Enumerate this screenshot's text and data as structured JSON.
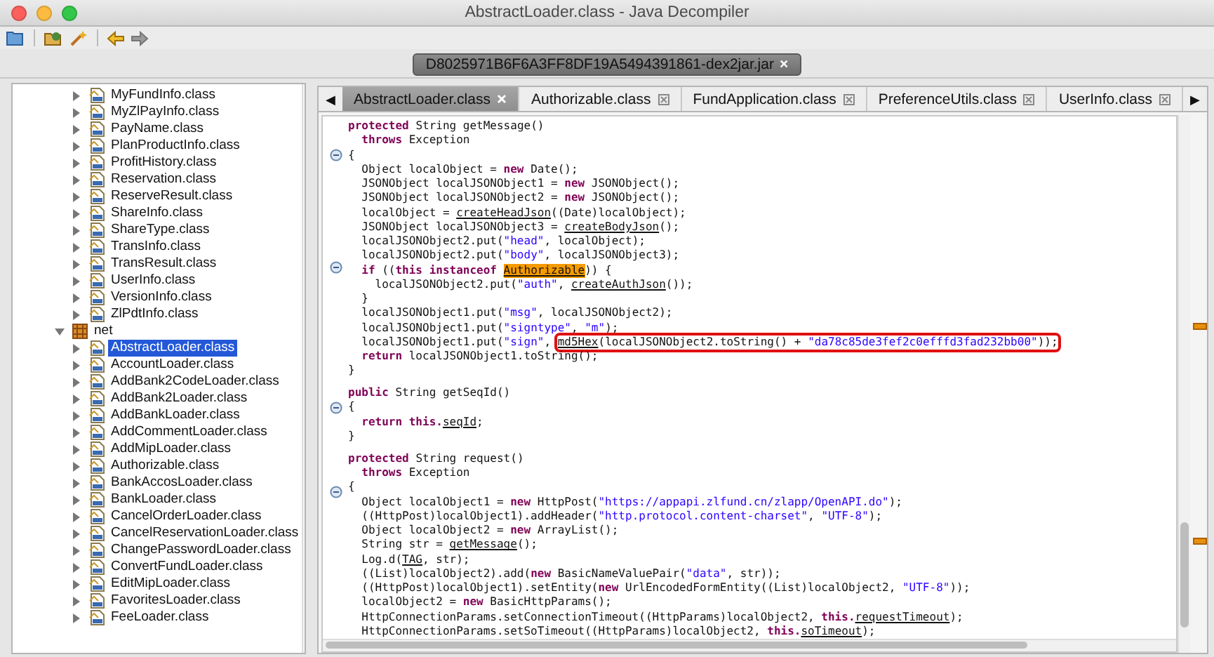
{
  "window": {
    "title": "AbstractLoader.class - Java Decompiler"
  },
  "jar_tab": {
    "label": "D8025971B6F6A3FF8DF19A5494391861-dex2jar.jar",
    "close": "×"
  },
  "tree": {
    "items": [
      {
        "kind": "class",
        "label": "MyFundInfo.class",
        "selected": false,
        "expanded": false
      },
      {
        "kind": "class",
        "label": "MyZlPayInfo.class",
        "selected": false,
        "expanded": false
      },
      {
        "kind": "class",
        "label": "PayName.class",
        "selected": false,
        "expanded": false
      },
      {
        "kind": "class",
        "label": "PlanProductInfo.class",
        "selected": false,
        "expanded": false
      },
      {
        "kind": "class",
        "label": "ProfitHistory.class",
        "selected": false,
        "expanded": false
      },
      {
        "kind": "class",
        "label": "Reservation.class",
        "selected": false,
        "expanded": false
      },
      {
        "kind": "class",
        "label": "ReserveResult.class",
        "selected": false,
        "expanded": false
      },
      {
        "kind": "class",
        "label": "ShareInfo.class",
        "selected": false,
        "expanded": false
      },
      {
        "kind": "class",
        "label": "ShareType.class",
        "selected": false,
        "expanded": false
      },
      {
        "kind": "class",
        "label": "TransInfo.class",
        "selected": false,
        "expanded": false
      },
      {
        "kind": "class",
        "label": "TransResult.class",
        "selected": false,
        "expanded": false
      },
      {
        "kind": "class",
        "label": "UserInfo.class",
        "selected": false,
        "expanded": false
      },
      {
        "kind": "class",
        "label": "VersionInfo.class",
        "selected": false,
        "expanded": false
      },
      {
        "kind": "class",
        "label": "ZlPdtInfo.class",
        "selected": false,
        "expanded": false
      },
      {
        "kind": "package",
        "label": "net",
        "selected": false,
        "expanded": true,
        "children": [
          {
            "kind": "class",
            "label": "AbstractLoader.class",
            "selected": true,
            "expanded": false
          },
          {
            "kind": "class",
            "label": "AccountLoader.class",
            "selected": false,
            "expanded": false
          },
          {
            "kind": "class",
            "label": "AddBank2CodeLoader.class",
            "selected": false,
            "expanded": false
          },
          {
            "kind": "class",
            "label": "AddBank2Loader.class",
            "selected": false,
            "expanded": false
          },
          {
            "kind": "class",
            "label": "AddBankLoader.class",
            "selected": false,
            "expanded": false
          },
          {
            "kind": "class",
            "label": "AddCommentLoader.class",
            "selected": false,
            "expanded": false
          },
          {
            "kind": "class",
            "label": "AddMipLoader.class",
            "selected": false,
            "expanded": false
          },
          {
            "kind": "class",
            "label": "Authorizable.class",
            "selected": false,
            "expanded": false
          },
          {
            "kind": "class",
            "label": "BankAccosLoader.class",
            "selected": false,
            "expanded": false
          },
          {
            "kind": "class",
            "label": "BankLoader.class",
            "selected": false,
            "expanded": false
          },
          {
            "kind": "class",
            "label": "CancelOrderLoader.class",
            "selected": false,
            "expanded": false
          },
          {
            "kind": "class",
            "label": "CancelReservationLoader.class",
            "selected": false,
            "expanded": false
          },
          {
            "kind": "class",
            "label": "ChangePasswordLoader.class",
            "selected": false,
            "expanded": false
          },
          {
            "kind": "class",
            "label": "ConvertFundLoader.class",
            "selected": false,
            "expanded": false
          },
          {
            "kind": "class",
            "label": "EditMipLoader.class",
            "selected": false,
            "expanded": false
          },
          {
            "kind": "class",
            "label": "FavoritesLoader.class",
            "selected": false,
            "expanded": false
          },
          {
            "kind": "class",
            "label": "FeeLoader.class",
            "selected": false,
            "expanded": false
          }
        ]
      }
    ]
  },
  "editor_tabs": {
    "prev": "◀",
    "next": "▶",
    "tabs": [
      {
        "label": "AbstractLoader.class",
        "selected": true
      },
      {
        "label": "Authorizable.class",
        "selected": false
      },
      {
        "label": "FundApplication.class",
        "selected": false
      },
      {
        "label": "PreferenceUtils.class",
        "selected": false
      },
      {
        "label": "UserInfo.class",
        "selected": false
      }
    ]
  },
  "code": {
    "lines": [
      {
        "fold": false,
        "tokens": [
          {
            "kind": "keyword",
            "text": "protected"
          },
          {
            "kind": "plain",
            "text": " String getMessage()"
          }
        ]
      },
      {
        "fold": false,
        "tokens": [
          {
            "kind": "keyword",
            "text": "  throws"
          },
          {
            "kind": "plain",
            "text": " Exception"
          }
        ]
      },
      {
        "fold": true,
        "tokens": [
          {
            "kind": "plain",
            "text": "{"
          }
        ]
      },
      {
        "fold": false,
        "tokens": [
          {
            "kind": "plain",
            "text": "  Object localObject = "
          },
          {
            "kind": "keyword",
            "text": "new"
          },
          {
            "kind": "plain",
            "text": " Date();"
          }
        ]
      },
      {
        "fold": false,
        "tokens": [
          {
            "kind": "plain",
            "text": "  JSONObject localJSONObject1 = "
          },
          {
            "kind": "keyword",
            "text": "new"
          },
          {
            "kind": "plain",
            "text": " JSONObject();"
          }
        ]
      },
      {
        "fold": false,
        "tokens": [
          {
            "kind": "plain",
            "text": "  JSONObject localJSONObject2 = "
          },
          {
            "kind": "keyword",
            "text": "new"
          },
          {
            "kind": "plain",
            "text": " JSONObject();"
          }
        ]
      },
      {
        "fold": false,
        "tokens": [
          {
            "kind": "plain",
            "text": "  localObject = "
          },
          {
            "kind": "link",
            "text": "createHeadJson"
          },
          {
            "kind": "plain",
            "text": "((Date)localObject);"
          }
        ]
      },
      {
        "fold": false,
        "tokens": [
          {
            "kind": "plain",
            "text": "  JSONObject localJSONObject3 = "
          },
          {
            "kind": "link",
            "text": "createBodyJson"
          },
          {
            "kind": "plain",
            "text": "();"
          }
        ]
      },
      {
        "fold": false,
        "tokens": [
          {
            "kind": "plain",
            "text": "  localJSONObject2.put("
          },
          {
            "kind": "string",
            "text": "\"head\""
          },
          {
            "kind": "plain",
            "text": ", localObject);"
          }
        ]
      },
      {
        "fold": false,
        "tokens": [
          {
            "kind": "plain",
            "text": "  localJSONObject2.put("
          },
          {
            "kind": "string",
            "text": "\"body\""
          },
          {
            "kind": "plain",
            "text": ", localJSONObject3);"
          }
        ]
      },
      {
        "fold": true,
        "tokens": [
          {
            "kind": "keyword",
            "text": "  if"
          },
          {
            "kind": "plain",
            "text": " (("
          },
          {
            "kind": "keyword",
            "text": "this instanceof "
          },
          {
            "kind": "highlight",
            "text": "Authorizable"
          },
          {
            "kind": "plain",
            "text": ")) {"
          }
        ]
      },
      {
        "fold": false,
        "tokens": [
          {
            "kind": "plain",
            "text": "    localJSONObject2.put("
          },
          {
            "kind": "string",
            "text": "\"auth\""
          },
          {
            "kind": "plain",
            "text": ", "
          },
          {
            "kind": "link",
            "text": "createAuthJson"
          },
          {
            "kind": "plain",
            "text": "());"
          }
        ]
      },
      {
        "fold": false,
        "tokens": [
          {
            "kind": "plain",
            "text": "  }"
          }
        ]
      },
      {
        "fold": false,
        "tokens": [
          {
            "kind": "plain",
            "text": "  localJSONObject1.put("
          },
          {
            "kind": "string",
            "text": "\"msg\""
          },
          {
            "kind": "plain",
            "text": ", localJSONObject2);"
          }
        ]
      },
      {
        "fold": false,
        "tokens": [
          {
            "kind": "plain",
            "text": "  localJSONObject1.put("
          },
          {
            "kind": "string",
            "text": "\"signtype\""
          },
          {
            "kind": "plain",
            "text": ", "
          },
          {
            "kind": "string",
            "text": "\"m\""
          },
          {
            "kind": "plain",
            "text": ");"
          }
        ]
      },
      {
        "fold": false,
        "tokens": [
          {
            "kind": "plain",
            "text": "  localJSONObject1.put("
          },
          {
            "kind": "string",
            "text": "\"sign\""
          },
          {
            "kind": "plain",
            "text": ", "
          }
        ],
        "boxed": [
          {
            "kind": "link",
            "text": "md5Hex"
          },
          {
            "kind": "plain",
            "text": "(localJSONObject2.toString() + "
          },
          {
            "kind": "string",
            "text": "\"da78c85de3fef2c0efffd3fad232bb00\""
          },
          {
            "kind": "plain",
            "text": "));"
          }
        ]
      },
      {
        "fold": false,
        "tokens": [
          {
            "kind": "keyword",
            "text": "  return"
          },
          {
            "kind": "plain",
            "text": " localJSONObject1.toString();"
          }
        ]
      },
      {
        "fold": false,
        "tokens": [
          {
            "kind": "plain",
            "text": "}"
          }
        ]
      },
      {
        "fold": false
      },
      {
        "fold": false,
        "tokens": [
          {
            "kind": "keyword",
            "text": "public"
          },
          {
            "kind": "plain",
            "text": " String getSeqId()"
          }
        ]
      },
      {
        "fold": true,
        "tokens": [
          {
            "kind": "plain",
            "text": "{"
          }
        ]
      },
      {
        "fold": false,
        "tokens": [
          {
            "kind": "keyword",
            "text": "  return this."
          },
          {
            "kind": "link",
            "text": "seqId"
          },
          {
            "kind": "plain",
            "text": ";"
          }
        ]
      },
      {
        "fold": false,
        "tokens": [
          {
            "kind": "plain",
            "text": "}"
          }
        ]
      },
      {
        "fold": false
      },
      {
        "fold": false,
        "tokens": [
          {
            "kind": "keyword",
            "text": "protected"
          },
          {
            "kind": "plain",
            "text": " String request()"
          }
        ]
      },
      {
        "fold": false,
        "tokens": [
          {
            "kind": "keyword",
            "text": "  throws"
          },
          {
            "kind": "plain",
            "text": " Exception"
          }
        ]
      },
      {
        "fold": true,
        "tokens": [
          {
            "kind": "plain",
            "text": "{"
          }
        ]
      },
      {
        "fold": false,
        "tokens": [
          {
            "kind": "plain",
            "text": "  Object localObject1 = "
          },
          {
            "kind": "keyword",
            "text": "new"
          },
          {
            "kind": "plain",
            "text": " HttpPost("
          },
          {
            "kind": "string",
            "text": "\"https://appapi.zlfund.cn/zlapp/OpenAPI.do\""
          },
          {
            "kind": "plain",
            "text": ");"
          }
        ]
      },
      {
        "fold": false,
        "tokens": [
          {
            "kind": "plain",
            "text": "  ((HttpPost)localObject1).addHeader("
          },
          {
            "kind": "string",
            "text": "\"http.protocol.content-charset\""
          },
          {
            "kind": "plain",
            "text": ", "
          },
          {
            "kind": "string",
            "text": "\"UTF-8\""
          },
          {
            "kind": "plain",
            "text": ");"
          }
        ]
      },
      {
        "fold": false,
        "tokens": [
          {
            "kind": "plain",
            "text": "  Object localObject2 = "
          },
          {
            "kind": "keyword",
            "text": "new"
          },
          {
            "kind": "plain",
            "text": " ArrayList();"
          }
        ]
      },
      {
        "fold": false,
        "tokens": [
          {
            "kind": "plain",
            "text": "  String str = "
          },
          {
            "kind": "link",
            "text": "getMessage"
          },
          {
            "kind": "plain",
            "text": "();"
          }
        ]
      },
      {
        "fold": false,
        "tokens": [
          {
            "kind": "plain",
            "text": "  Log.d("
          },
          {
            "kind": "link",
            "text": "TAG"
          },
          {
            "kind": "plain",
            "text": ", str);"
          }
        ]
      },
      {
        "fold": false,
        "tokens": [
          {
            "kind": "plain",
            "text": "  ((List)localObject2).add("
          },
          {
            "kind": "keyword",
            "text": "new"
          },
          {
            "kind": "plain",
            "text": " BasicNameValuePair("
          },
          {
            "kind": "string",
            "text": "\"data\""
          },
          {
            "kind": "plain",
            "text": ", str));"
          }
        ]
      },
      {
        "fold": false,
        "tokens": [
          {
            "kind": "plain",
            "text": "  ((HttpPost)localObject1).setEntity("
          },
          {
            "kind": "keyword",
            "text": "new"
          },
          {
            "kind": "plain",
            "text": " UrlEncodedFormEntity((List)localObject2, "
          },
          {
            "kind": "string",
            "text": "\"UTF-8\""
          },
          {
            "kind": "plain",
            "text": "));"
          }
        ]
      },
      {
        "fold": false,
        "tokens": [
          {
            "kind": "plain",
            "text": "  localObject2 = "
          },
          {
            "kind": "keyword",
            "text": "new"
          },
          {
            "kind": "plain",
            "text": " BasicHttpParams();"
          }
        ]
      },
      {
        "fold": false,
        "tokens": [
          {
            "kind": "plain",
            "text": "  HttpConnectionParams.setConnectionTimeout((HttpParams)localObject2, "
          },
          {
            "kind": "keyword",
            "text": "this."
          },
          {
            "kind": "link",
            "text": "requestTimeout"
          },
          {
            "kind": "plain",
            "text": ");"
          }
        ]
      },
      {
        "fold": false,
        "tokens": [
          {
            "kind": "plain",
            "text": "  HttpConnectionParams.setSoTimeout((HttpParams)localObject2, "
          },
          {
            "kind": "keyword",
            "text": "this."
          },
          {
            "kind": "link",
            "text": "soTimeout"
          },
          {
            "kind": "plain",
            "text": ");"
          }
        ]
      }
    ]
  }
}
